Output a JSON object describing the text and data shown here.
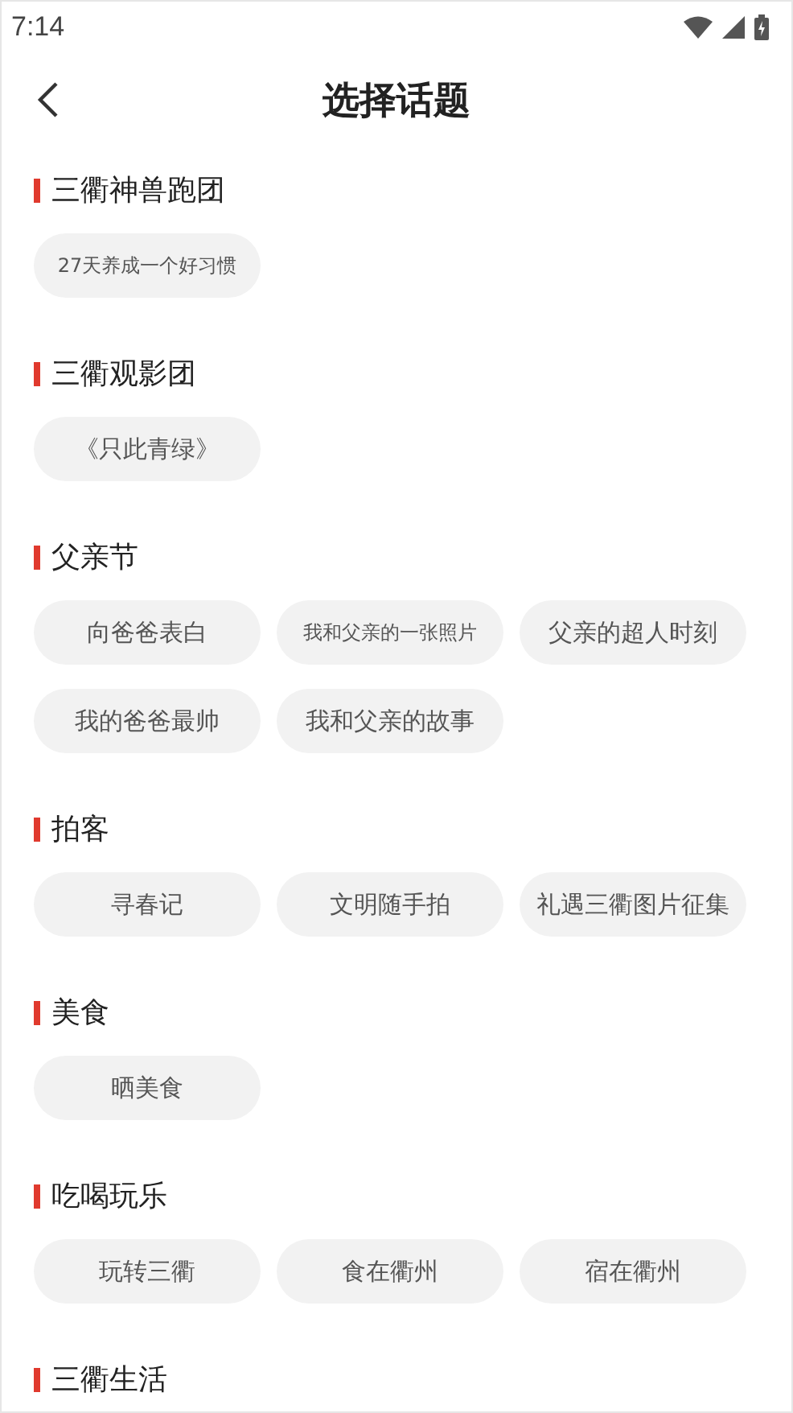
{
  "status_bar": {
    "time": "7:14"
  },
  "header": {
    "title": "选择话题"
  },
  "sections": [
    {
      "title": "三衢神兽跑团",
      "chips": [
        {
          "label": "27天养成一个好习惯",
          "kind": "small"
        }
      ]
    },
    {
      "title": "三衢观影团",
      "chips": [
        {
          "label": "《只此青绿》",
          "kind": "normal"
        }
      ]
    },
    {
      "title": "父亲节",
      "chips": [
        {
          "label": "向爸爸表白",
          "kind": "normal"
        },
        {
          "label": "我和父亲的一张照片",
          "kind": "small"
        },
        {
          "label": "父亲的超人时刻",
          "kind": "normal"
        },
        {
          "label": "我的爸爸最帅",
          "kind": "normal"
        },
        {
          "label": "我和父亲的故事",
          "kind": "normal"
        }
      ]
    },
    {
      "title": "拍客",
      "chips": [
        {
          "label": "寻春记",
          "kind": "normal"
        },
        {
          "label": "文明随手拍",
          "kind": "normal"
        },
        {
          "label": "礼遇三衢图片征集",
          "kind": "normal"
        }
      ]
    },
    {
      "title": "美食",
      "chips": [
        {
          "label": "晒美食",
          "kind": "normal"
        }
      ]
    },
    {
      "title": "吃喝玩乐",
      "chips": [
        {
          "label": "玩转三衢",
          "kind": "normal"
        },
        {
          "label": "食在衢州",
          "kind": "normal"
        },
        {
          "label": "宿在衢州",
          "kind": "normal"
        }
      ]
    },
    {
      "title": "三衢生活"
    }
  ]
}
